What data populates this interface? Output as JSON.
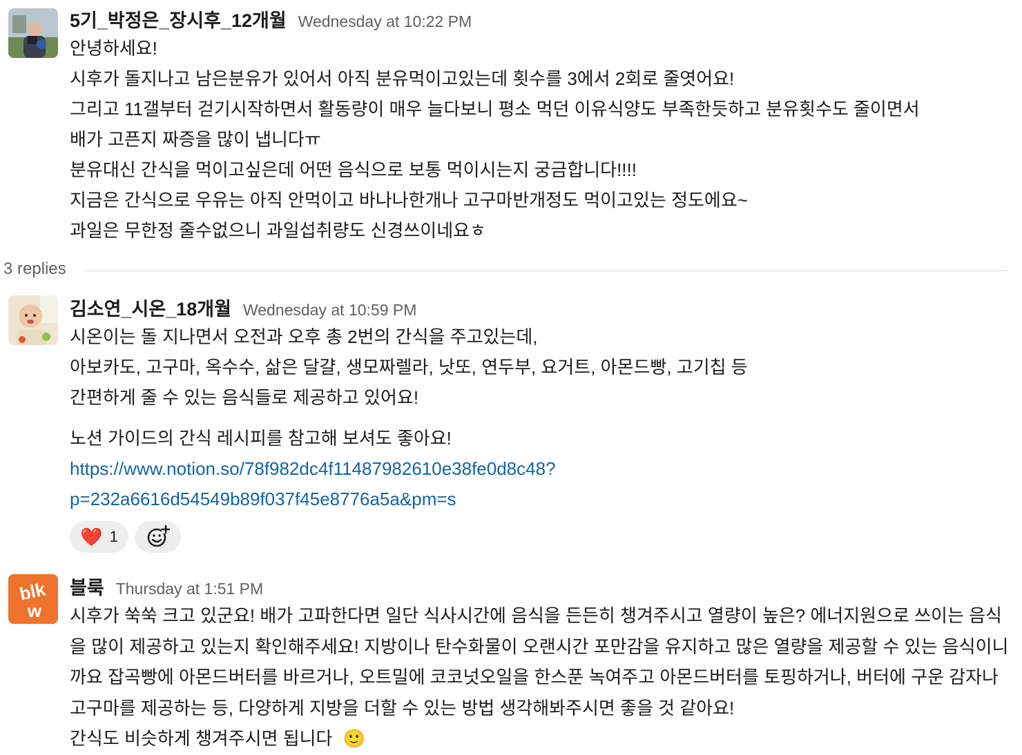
{
  "messages": [
    {
      "author": "5기_박정은_장시후_12개월",
      "time": "Wednesday at 10:22 PM",
      "lines": [
        "안녕하세요!",
        "시후가 돌지나고 남은분유가 있어서 아직 분유먹이고있는데 횟수를 3에서 2회로 줄엿어요!",
        "그리고 11갤부터 걷기시작하면서 활동량이 매우 늘다보니 평소 먹던 이유식양도 부족한듯하고 분유횟수도 줄이면서",
        "배가 고픈지 짜증을 많이 냅니다ㅠ",
        "분유대신 간식을 먹이고싶은데 어떤 음식으로 보통 먹이시는지 궁금합니다!!!!",
        "지금은 간식으로 우유는 아직 안먹이고 바나나한개나 고구마반개정도 먹이고있는 정도에요~",
        "과일은 무한정 줄수없으니 과일섭취량도 신경쓰이네요ㅎ"
      ]
    },
    {
      "author": "김소연_시온_18개월",
      "time": "Wednesday at 10:59 PM",
      "lines": [
        "시온이는 돌 지나면서 오전과 오후 총 2번의 간식을 주고있는데,",
        "아보카도, 고구마, 옥수수, 삶은 달걀, 생모짜렐라, 낫또, 연두부, 요거트, 아몬드빵, 고기칩 등",
        "간편하게 줄 수 있는 음식들로 제공하고 있어요!"
      ],
      "lines2": [
        "노션 가이드의 간식 레시피를 참고해 보셔도 좋아요!"
      ],
      "link_lines": [
        "https://www.notion.so/78f982dc4f11487982610e38fe0d8c48?",
        "p=232a6616d54549b89f037f45e8776a5a&pm=s"
      ],
      "reaction": {
        "emoji": "❤️",
        "count": "1"
      },
      "add_reaction_icon": "add-reaction-icon"
    },
    {
      "author": "블룩",
      "time": "Thursday at 1:51 PM",
      "avatar_text": "blkw",
      "avatar_color": "#f0732d",
      "body": "시후가 쑥쑥 크고 있군요! 배가 고파한다면 일단 식사시간에 음식을 든든히 챙겨주시고 열량이 높은? 에너지원으로 쓰이는 음식을 많이 제공하고 있는지 확인해주세요! 지방이나 탄수화물이 오랜시간 포만감을 유지하고 많은 열량을 제공할 수 있는 음식이니까요 잡곡빵에 아몬드버터를 바르거나, 오트밀에 코코넛오일을 한스푼 녹여주고 아몬드버터를 토핑하거나, 버터에 구운 감자나 고구마를 제공하는 등, 다양하게 지방을 더할 수 있는 방법 생각해봐주시면 좋을 것 같아요!",
      "last_line": "간식도 비슷하게 챙겨주시면 됩니다",
      "emoji": "🙂"
    }
  ],
  "thread": {
    "replies": "3 replies"
  }
}
